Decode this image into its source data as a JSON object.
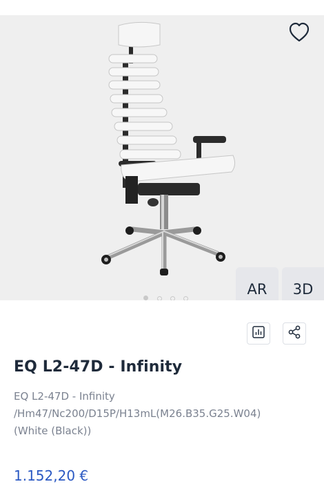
{
  "gallery": {
    "slide_count": 4,
    "active_slide": 1,
    "ar_label": "AR",
    "three_d_label": "3D"
  },
  "icons": {
    "favorite": "heart-icon",
    "compare": "bar-chart-icon",
    "share": "share-icon"
  },
  "product": {
    "title": "EQ L2-47D - Infinity",
    "description_lines": [
      "EQ L2-47D - Infinity",
      "/Hm47/Nc200/D15P/H13mL(M26.B35.G25.W04)",
      "(White (Black))"
    ],
    "price": "1.152,20 €"
  },
  "colors": {
    "text": "#1e2a3a",
    "muted": "#7b8290",
    "price": "#2b59c3",
    "gallery_bg": "#efefef",
    "pill_bg": "#e6e7eb"
  }
}
